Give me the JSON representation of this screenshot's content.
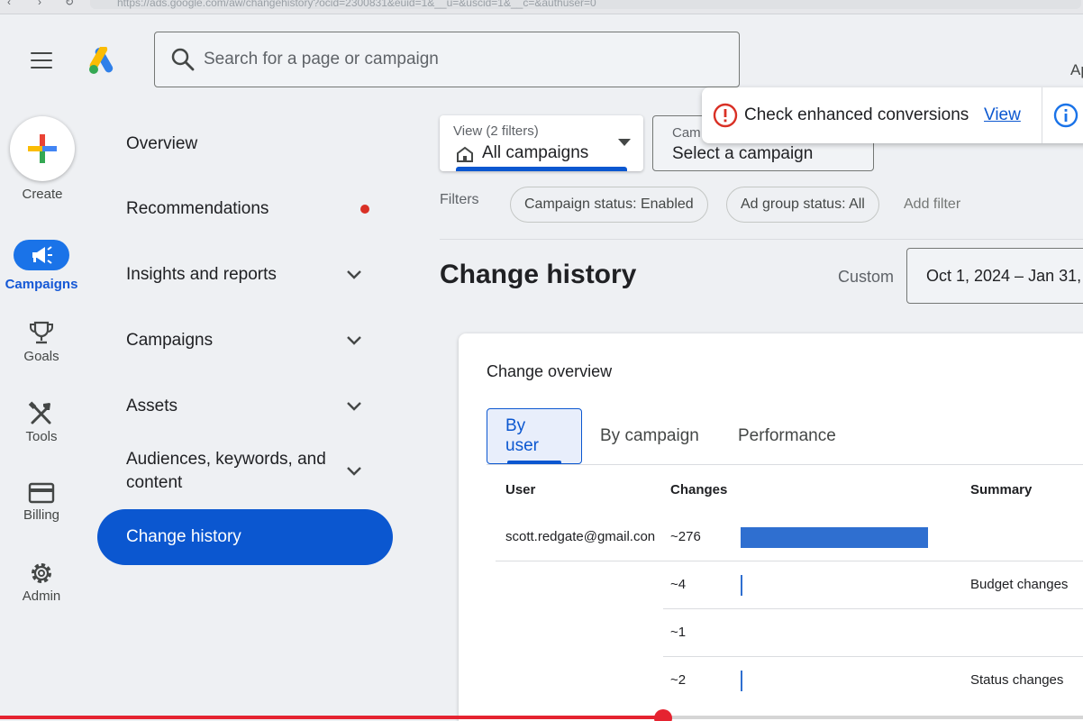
{
  "browser": {
    "url": "https://ads.google.com/aw/changehistory?ocid=2300831&euid=1&__u=&uscid=1&__c=&authuser=0"
  },
  "header": {
    "search_placeholder": "Search for a page or campaign",
    "account_cut": "Ap"
  },
  "rail": {
    "create_label": "Create",
    "items": [
      {
        "label": "Campaigns",
        "icon": "megaphone-icon",
        "active": true
      },
      {
        "label": "Goals",
        "icon": "trophy-icon"
      },
      {
        "label": "Tools",
        "icon": "tools-icon"
      },
      {
        "label": "Billing",
        "icon": "credit-card-icon"
      },
      {
        "label": "Admin",
        "icon": "gear-icon"
      }
    ]
  },
  "sidenav": {
    "items": [
      {
        "label": "Overview"
      },
      {
        "label": "Recommendations",
        "badge": "red-dot"
      },
      {
        "label": "Insights and reports",
        "expandable": true
      },
      {
        "label": "Campaigns",
        "expandable": true
      },
      {
        "label": "Assets",
        "expandable": true
      },
      {
        "label": "Audiences, keywords, and content",
        "expandable": true
      },
      {
        "label": "Change history",
        "selected": true
      }
    ]
  },
  "view_selector": {
    "label": "View (2 filters)",
    "value": "All campaigns"
  },
  "campaign_selector": {
    "label": "Cam",
    "value": "Select a campaign"
  },
  "toast": {
    "message": "Check enhanced conversions",
    "link": "View"
  },
  "filters": {
    "label": "Filters",
    "chips": [
      "Campaign status: Enabled",
      "Ad group status: All"
    ],
    "add_label": "Add filter"
  },
  "page": {
    "title": "Change history",
    "date_label": "Custom",
    "date_range": "Oct 1, 2024 – Jan 31,"
  },
  "overview": {
    "title": "Change overview",
    "tabs": [
      "By user",
      "By campaign",
      "Performance"
    ],
    "active_tab": "By user",
    "columns": [
      "User",
      "Changes",
      "Summary"
    ],
    "rows": [
      {
        "user": "scott.redgate@gmail.con",
        "changes": "~276",
        "count": 276,
        "summary": ""
      },
      {
        "user": "",
        "changes": "~4",
        "count": 4,
        "summary": "Budget changes"
      },
      {
        "user": "",
        "changes": "~1",
        "count": 1,
        "summary": ""
      },
      {
        "user": "",
        "changes": "~2",
        "count": 2,
        "summary": "Status changes"
      }
    ]
  },
  "colors": {
    "accent": "#0b57d0",
    "bar": "#2f6fd0",
    "error": "#d93025",
    "progress": "#e52330"
  },
  "video_progress": 0.612
}
